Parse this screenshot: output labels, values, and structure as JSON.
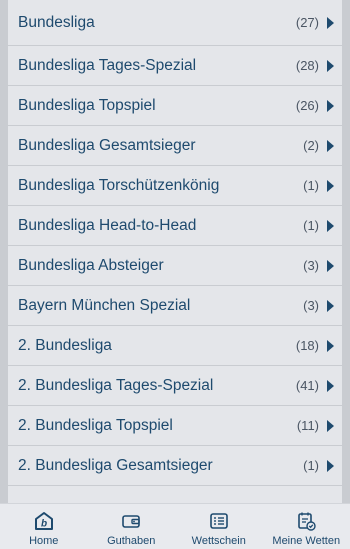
{
  "list": {
    "items": [
      {
        "label": "Bundesliga",
        "count": "(27)"
      },
      {
        "label": "Bundesliga Tages-Spezial",
        "count": "(28)"
      },
      {
        "label": "Bundesliga Topspiel",
        "count": "(26)"
      },
      {
        "label": "Bundesliga Gesamtsieger",
        "count": "(2)"
      },
      {
        "label": "Bundesliga Torschützenkönig",
        "count": "(1)"
      },
      {
        "label": "Bundesliga Head-to-Head",
        "count": "(1)"
      },
      {
        "label": "Bundesliga Absteiger",
        "count": "(3)"
      },
      {
        "label": "Bayern München Spezial",
        "count": "(3)"
      },
      {
        "label": "2. Bundesliga",
        "count": "(18)"
      },
      {
        "label": "2. Bundesliga Tages-Spezial",
        "count": "(41)"
      },
      {
        "label": "2. Bundesliga Topspiel",
        "count": "(11)"
      },
      {
        "label": "2. Bundesliga Gesamtsieger",
        "count": "(1)"
      }
    ]
  },
  "bottom_nav": {
    "tabs": [
      {
        "label": "Home",
        "icon": "home-icon"
      },
      {
        "label": "Guthaben",
        "icon": "wallet-icon"
      },
      {
        "label": "Wettschein",
        "icon": "betslip-icon"
      },
      {
        "label": "Meine Wetten",
        "icon": "my-bets-icon"
      }
    ]
  },
  "colors": {
    "text": "#1e4a6e",
    "row_bg": "#e4e6ea",
    "divider": "#c9ccd1"
  }
}
